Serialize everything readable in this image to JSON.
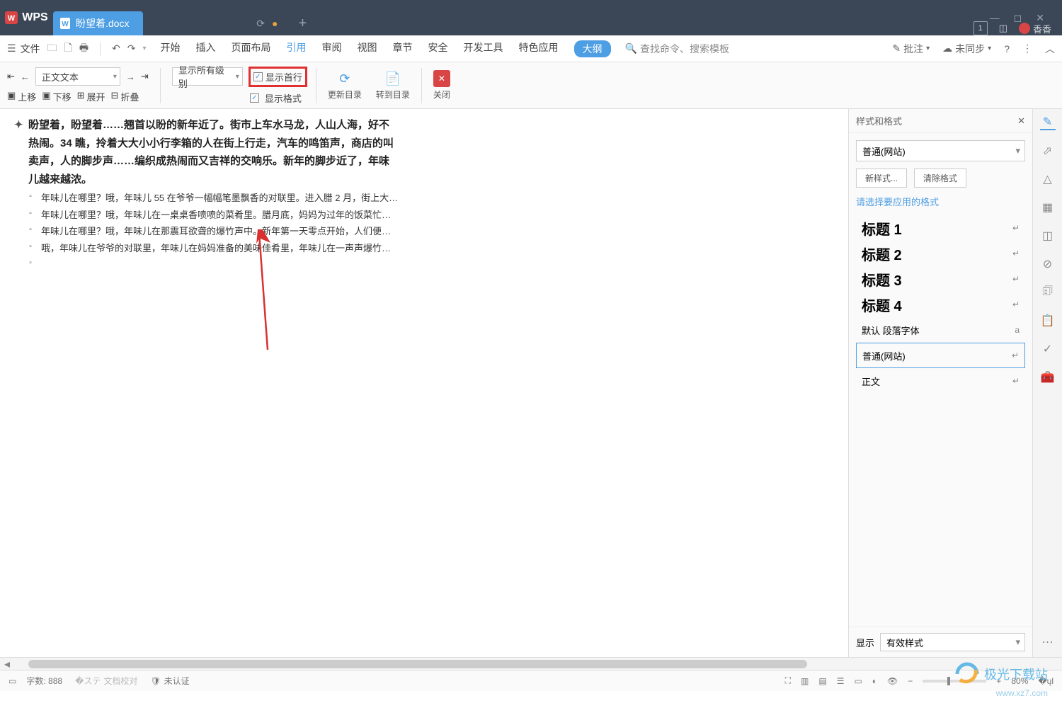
{
  "title": {
    "wps": "WPS",
    "doc_tab": "盼望着.docx"
  },
  "menubar": {
    "file": "文件",
    "tabs": [
      "开始",
      "插入",
      "页面布局",
      "引用",
      "审阅",
      "视图",
      "章节",
      "安全",
      "开发工具",
      "特色应用",
      "大纲"
    ],
    "active_idx": 3,
    "pill_idx": 10,
    "search": "查找命令、搜索模板",
    "right": {
      "annot": "批注",
      "sync": "未同步"
    }
  },
  "toolbar": {
    "body_style": "正文文本",
    "level": "显示所有级别",
    "show_first": "显示首行",
    "show_format": "显示格式",
    "up": "上移",
    "down": "下移",
    "expand": "展开",
    "collapse": "折叠",
    "update": "更新目录",
    "goto": "转到目录",
    "close": "关闭"
  },
  "doc": {
    "main": "盼望着，盼望着……翘首以盼的新年近了。街市上车水马龙，人山人海，好不热闹。34 瞧，拎着大大小小行李箱的人在街上行走，汽车的鸣笛声，商店的叫卖声，人的脚步声……编织成热闹而又吉祥的交响乐。新年的脚步近了，年味儿越来越浓。",
    "lines": [
      "年味儿在哪里？哦，年味儿 55 在爷爷一幅幅笔墨飘香的对联里。进入腊 2 月，街上大…",
      "年味儿在哪里？哦，年味儿在一桌桌香喷喷的菜肴里。腊月底，妈妈为过年的饭菜忙…",
      "年味儿在哪里？哦，年味儿在那震耳欲聋的爆竹声中。新年第一天零点开始，人们便…",
      "哦，年味儿在爷爷的对联里，年味儿在妈妈准备的美味佳肴里，年味儿在一声声爆竹…"
    ]
  },
  "panel": {
    "title": "样式和格式",
    "current": "普通(网站)",
    "new": "新样式...",
    "clear": "清除格式",
    "hint": "请选择要应用的格式",
    "styles": [
      "标题 1",
      "标题 2",
      "标题 3",
      "标题 4"
    ],
    "default_font": "默认 段落字体",
    "normal_web": "普通(网站)",
    "body": "正文",
    "show": "显示",
    "show_val": "有效样式"
  },
  "status": {
    "pages": "",
    "words_lbl": "字数:",
    "words": "888",
    "proof": "文档校对",
    "cert": "未认证",
    "zoom": "80%"
  },
  "user": "香香",
  "watermark": {
    "main": "极光下载站",
    "sub": "www.xz7.com"
  }
}
